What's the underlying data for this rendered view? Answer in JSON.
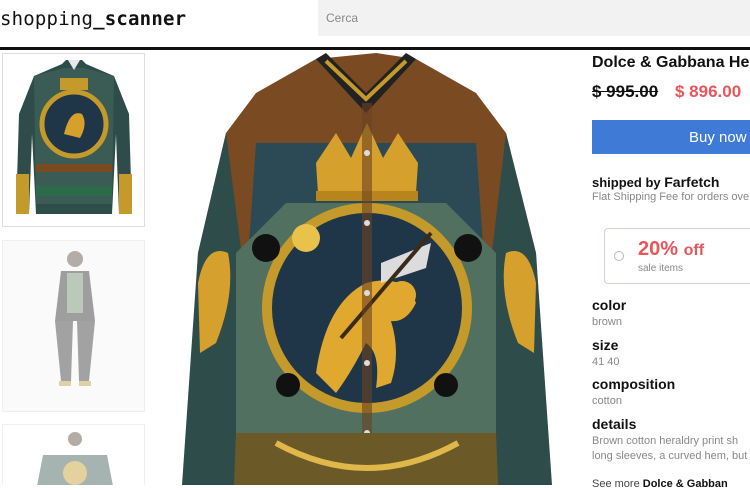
{
  "header": {
    "logo_prefix": "shopping",
    "logo_sep": "_",
    "logo_suffix": "scanner",
    "search_placeholder": "Cerca"
  },
  "gallery": {
    "thumbnails": [
      {
        "alt": "shirt front"
      },
      {
        "alt": "model wearing shirt"
      },
      {
        "alt": "shirt detail"
      }
    ]
  },
  "product": {
    "title": "Dolce & Gabbana Her",
    "old_price": "$ 995.00",
    "new_price": "$ 896.00",
    "buy_label": "Buy now",
    "shipped_by_text": "shipped by",
    "store": "Farfetch",
    "shipping_note": "Flat Shipping Fee for orders ove",
    "promo": {
      "percent": "20%",
      "off": "off",
      "subtitle": "sale items"
    },
    "attributes": [
      {
        "label": "color",
        "value": "brown"
      },
      {
        "label": "size",
        "value": "41 40"
      },
      {
        "label": "composition",
        "value": "cotton"
      },
      {
        "label": "details",
        "value": "Brown cotton heraldry print sh",
        "value2": "long sleeves, a curved hem, but"
      }
    ],
    "see_more_prefix": "See more",
    "see_more_brand": "Dolce & Gabban"
  },
  "colors": {
    "accent_blue": "#3f7bd6",
    "sale_red": "#e8555a"
  }
}
